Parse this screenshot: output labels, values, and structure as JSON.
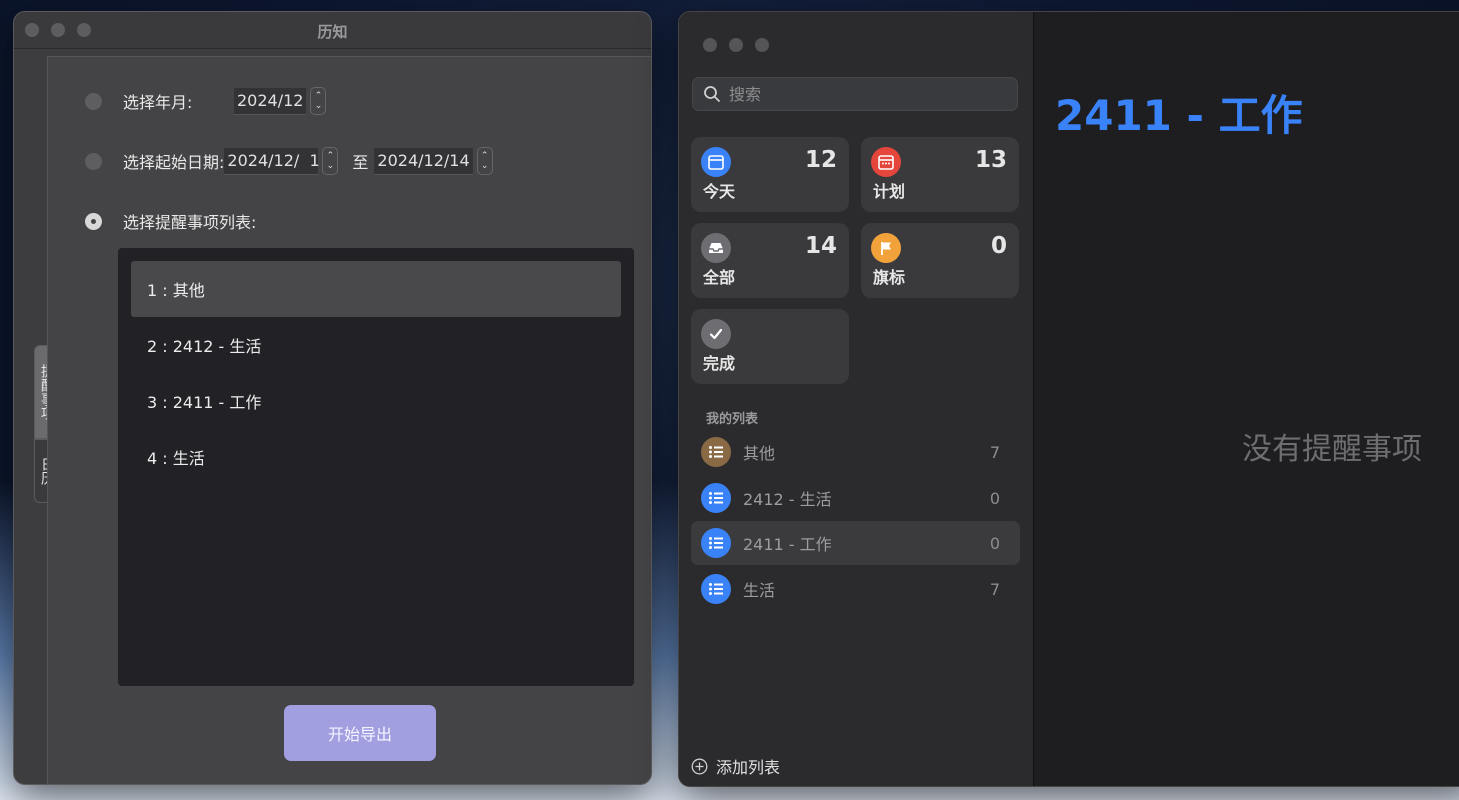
{
  "left_window": {
    "title": "历知",
    "tabs": [
      "提醒事项",
      "日历"
    ],
    "options": {
      "year_month_label": "选择年月:",
      "year_month_value": "2024/12",
      "date_range_label": "选择起始日期:",
      "date_start_value": "2024/12/  1",
      "date_sep": "至",
      "date_end_value": "2024/12/14",
      "reminder_lists_label": "选择提醒事项列表:"
    },
    "lists": [
      "1 : 其他",
      "2 : 2412 - 生活",
      "3 : 2411 - 工作",
      "4 : 生活"
    ],
    "export_button": "开始导出"
  },
  "reminders": {
    "search_placeholder": "搜索",
    "smart_lists": [
      {
        "label": "今天",
        "count": "12",
        "icon": "calendar-today-icon",
        "color": "#3a82f7"
      },
      {
        "label": "计划",
        "count": "13",
        "icon": "calendar-icon",
        "color": "#e5463c"
      },
      {
        "label": "全部",
        "count": "14",
        "icon": "tray-icon",
        "color": "#6d6d72"
      },
      {
        "label": "旗标",
        "count": "0",
        "icon": "flag-icon",
        "color": "#f2a23a"
      },
      {
        "label": "完成",
        "count": "",
        "icon": "checkmark-icon",
        "color": "#6d6d72"
      }
    ],
    "my_lists_title": "我的列表",
    "my_lists": [
      {
        "name": "其他",
        "count": "7",
        "color": "#8a6a44"
      },
      {
        "name": "2412 - 生活",
        "count": "0",
        "color": "#3a82f7"
      },
      {
        "name": "2411 - 工作",
        "count": "0",
        "color": "#3a82f7"
      },
      {
        "name": "生活",
        "count": "7",
        "color": "#3a82f7"
      }
    ],
    "add_list": "添加列表",
    "main_title": "2411 - 工作",
    "empty_message": "没有提醒事项",
    "accent_color": "#3a82f7"
  }
}
